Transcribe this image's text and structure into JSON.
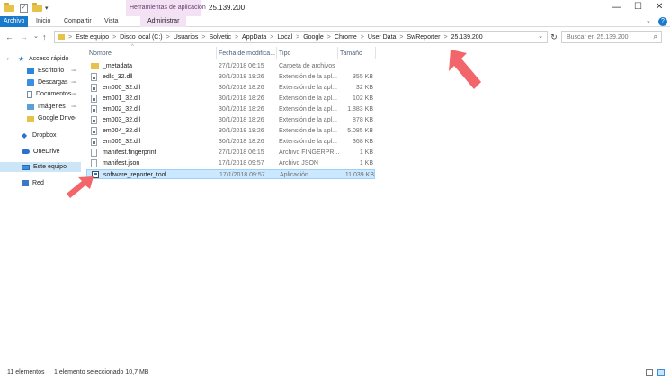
{
  "window": {
    "title": "25.139.200",
    "contextual_tab": "Herramientas de aplicación",
    "minimize": "—",
    "maximize": "☐",
    "close": "✕"
  },
  "quick_access": {
    "check": "✓",
    "dropdown": "▾"
  },
  "ribbon": {
    "tabs": [
      "Archivo",
      "Inicio",
      "Compartir",
      "Vista",
      "Administrar"
    ],
    "expand": "⌄",
    "help": "?"
  },
  "nav": {
    "back": "←",
    "forward": "→",
    "recent": "⌄",
    "up": "↑"
  },
  "address": {
    "crumbs": [
      "Este equipo",
      "Disco local (C:)",
      "Usuarios",
      "Solvetic",
      "AppData",
      "Local",
      "Google",
      "Chrome",
      "User Data",
      "SwReporter",
      "25.139.200"
    ],
    "separator": ">",
    "dropdown": "⌄",
    "refresh": "↻"
  },
  "search": {
    "placeholder": "Buscar en 25.139.200",
    "icon": "⌕"
  },
  "sidebar": {
    "items": [
      {
        "label": "Acceso rápido",
        "icon": "star-icon",
        "pinned": false
      },
      {
        "label": "Escritorio",
        "icon": "desktop-icon",
        "pinned": true
      },
      {
        "label": "Descargas",
        "icon": "download-icon",
        "pinned": true
      },
      {
        "label": "Documentos",
        "icon": "documents-icon",
        "pinned": true
      },
      {
        "label": "Imágenes",
        "icon": "pictures-icon",
        "pinned": true
      },
      {
        "label": "Google Drive",
        "icon": "folder-icon",
        "pinned": true
      },
      {
        "label": "Dropbox",
        "icon": "dropbox-icon",
        "pinned": false
      },
      {
        "label": "OneDrive",
        "icon": "onedrive-icon",
        "pinned": false
      },
      {
        "label": "Este equipo",
        "icon": "this-pc-icon",
        "pinned": false
      },
      {
        "label": "Red",
        "icon": "network-icon",
        "pinned": false
      }
    ],
    "pin_glyph": "⊸",
    "expander": "›"
  },
  "columns": {
    "name": "Nombre",
    "date": "Fecha de modifica...",
    "type": "Tipo",
    "size": "Tamaño",
    "sort_indicator": "^"
  },
  "files": [
    {
      "name": "_metadata",
      "date": "27/1/2018 06:15",
      "type": "Carpeta de archivos",
      "size": "",
      "kind": "folder"
    },
    {
      "name": "edls_32.dll",
      "date": "30/1/2018 18:26",
      "type": "Extensión de la apl...",
      "size": "355 KB",
      "kind": "dll"
    },
    {
      "name": "em000_32.dll",
      "date": "30/1/2018 18:26",
      "type": "Extensión de la apl...",
      "size": "32 KB",
      "kind": "dll"
    },
    {
      "name": "em001_32.dll",
      "date": "30/1/2018 18:26",
      "type": "Extensión de la apl...",
      "size": "102 KB",
      "kind": "dll"
    },
    {
      "name": "em002_32.dll",
      "date": "30/1/2018 18:26",
      "type": "Extensión de la apl...",
      "size": "1.883 KB",
      "kind": "dll"
    },
    {
      "name": "em003_32.dll",
      "date": "30/1/2018 18:26",
      "type": "Extensión de la apl...",
      "size": "878 KB",
      "kind": "dll"
    },
    {
      "name": "em004_32.dll",
      "date": "30/1/2018 18:26",
      "type": "Extensión de la apl...",
      "size": "5.085 KB",
      "kind": "dll"
    },
    {
      "name": "em005_32.dll",
      "date": "30/1/2018 18:26",
      "type": "Extensión de la apl...",
      "size": "368 KB",
      "kind": "dll"
    },
    {
      "name": "manifest.fingerprint",
      "date": "27/1/2018 06:15",
      "type": "Archivo FINGERPR...",
      "size": "1 KB",
      "kind": "file"
    },
    {
      "name": "manifest.json",
      "date": "17/1/2018 09:57",
      "type": "Archivo JSON",
      "size": "1 KB",
      "kind": "file"
    },
    {
      "name": "software_reporter_tool",
      "date": "17/1/2018 09:57",
      "type": "Aplicación",
      "size": "11.039 KB",
      "kind": "exe",
      "selected": true
    }
  ],
  "status": {
    "count": "11 elementos",
    "selection": "1 elemento seleccionado  10,7 MB"
  },
  "colors": {
    "accent": "#1979ca",
    "selection": "#cce8ff",
    "arrow": "#f2666b",
    "tools_tab": "#f3e2f4"
  }
}
